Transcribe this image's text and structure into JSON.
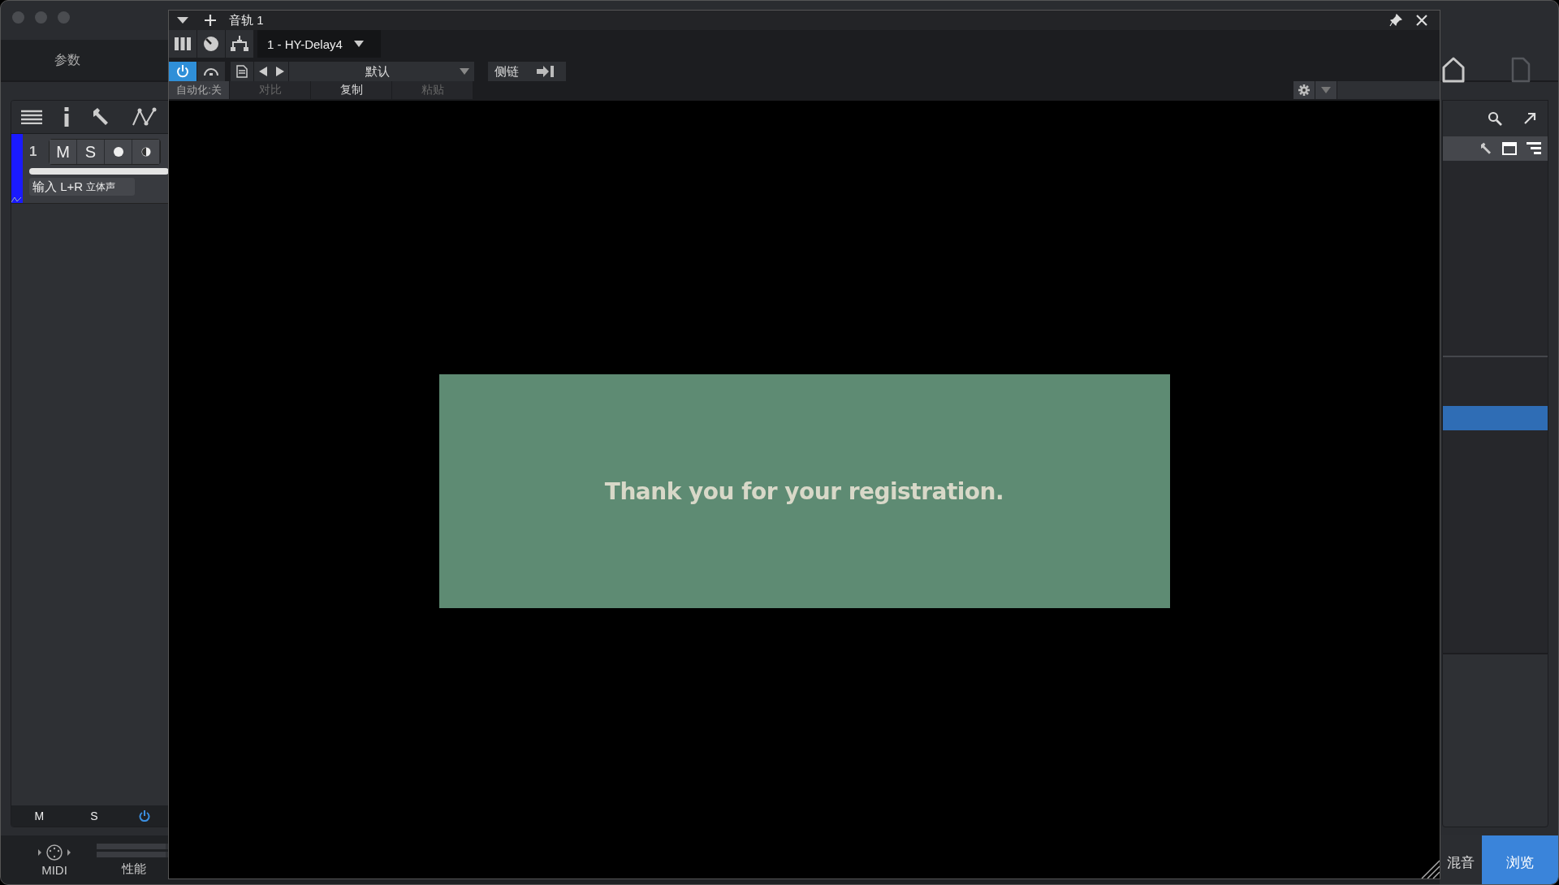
{
  "main_window": {
    "panel_title": "参数"
  },
  "track_panel": {
    "tracks": [
      {
        "number": "1",
        "color": "#1a1aff",
        "mute": "M",
        "solo": "S",
        "input": "输入 L+R",
        "channel_mode": "立体声",
        "level": 1
      }
    ],
    "footer": {
      "mute": "M",
      "solo": "S",
      "power_on": true
    }
  },
  "browser_panel": {
    "rows": [
      {
        "selected": true
      }
    ]
  },
  "status_bar": {
    "midi": "MIDI",
    "performance": "性能"
  },
  "bottom_tabs": [
    {
      "label": "混音",
      "selected": false
    },
    {
      "label": "浏览",
      "selected": true
    }
  ],
  "plugin_window": {
    "title": "音轨 1",
    "preset_slot": "1 - HY-Delay4",
    "power_on": true,
    "preset": "默认",
    "sidechain": "侧链",
    "automation": "自动化:关",
    "actions": [
      {
        "label": "对比",
        "disabled": true
      },
      {
        "label": "复制",
        "disabled": false
      },
      {
        "label": "粘贴",
        "disabled": true
      }
    ],
    "message": "Thank you for your registration."
  }
}
